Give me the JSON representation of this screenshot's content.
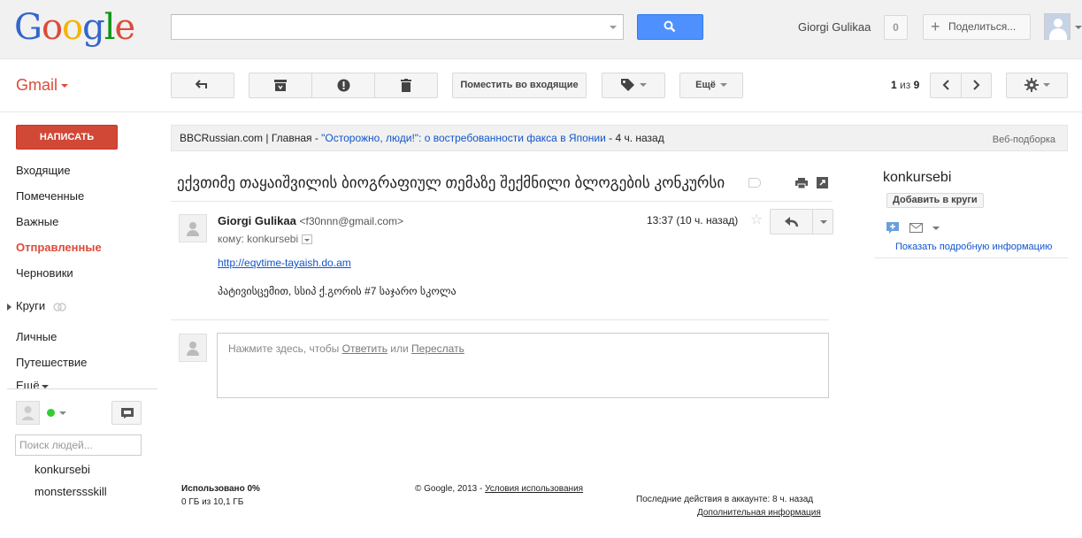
{
  "header": {
    "logo_letters": [
      "G",
      "o",
      "o",
      "g",
      "l",
      "e"
    ],
    "logo_colors": [
      "#3366cc",
      "#dd4b39",
      "#f4b400",
      "#3366cc",
      "#109618",
      "#dd4b39"
    ],
    "user_name": "Giorgi Gulikaa",
    "notification_count": "0",
    "share_label": "Поделиться..."
  },
  "app": {
    "title": "Gmail"
  },
  "toolbar": {
    "move_to_inbox": "Поместить во входящие",
    "more": "Ещё",
    "page_current": "1",
    "page_of": "из",
    "page_total": "9"
  },
  "sidebar": {
    "compose": "НАПИСАТЬ",
    "items": [
      {
        "label": "Входящие",
        "active": false
      },
      {
        "label": "Помеченные",
        "active": false
      },
      {
        "label": "Важные",
        "active": false
      },
      {
        "label": "Отправленные",
        "active": true
      },
      {
        "label": "Черновики",
        "active": false
      }
    ],
    "circles": "Круги",
    "circles_items": [
      "Личные",
      "Путешествие"
    ],
    "more": "Ещё",
    "people_search_placeholder": "Поиск людей...",
    "contacts": [
      "konkursebi",
      "monstersss­kill"
    ]
  },
  "web_clip": {
    "source": "BBCRussian.com | Главная - ",
    "headline": "\"Осторожно, люди!\": о востребованности факса в Японии",
    "age": " - 4 ч. назад",
    "tag": "Веб-подборка"
  },
  "thread": {
    "subject": "ექვთიმე თაყაიშვილის ბიოგრაფიულ თემაზე შექმნილი ბლოგების კონკურსი",
    "message": {
      "sender_name": "Giorgi Gulikaa",
      "sender_email": "<f30nnn@gmail.com>",
      "to_line": "кому: konkursebi",
      "time": "13:37 (10 ч. назад)",
      "link": "http://eqvtime-tayaish.do.am",
      "body": "პატივისცემით, სსიპ ქ.გორის #7 საჯარო სკოლა"
    },
    "reply_prompt": {
      "prefix": "Нажмите здесь, чтобы ",
      "reply": "Ответить",
      "or": " или ",
      "forward": "Переслать"
    }
  },
  "contact_panel": {
    "name": "konkursebi",
    "add_to_circles": "Добавить в круги",
    "details_link": "Показать подробную информацию"
  },
  "footer": {
    "usage_title": "Использовано 0%",
    "usage_detail": "0 ГБ из 10,1 ГБ",
    "copyright": "© Google, 2013 - ",
    "terms": "Условия использования",
    "last_activity": "Последние действия в аккаунте: 8 ч. назад",
    "details": "Дополнительная информация"
  },
  "colors": {
    "accent_red": "#dd4b39",
    "compose_red": "#d14836",
    "search_blue": "#4d90fe",
    "link_blue": "#1155cc",
    "online_green": "#33cc33"
  }
}
